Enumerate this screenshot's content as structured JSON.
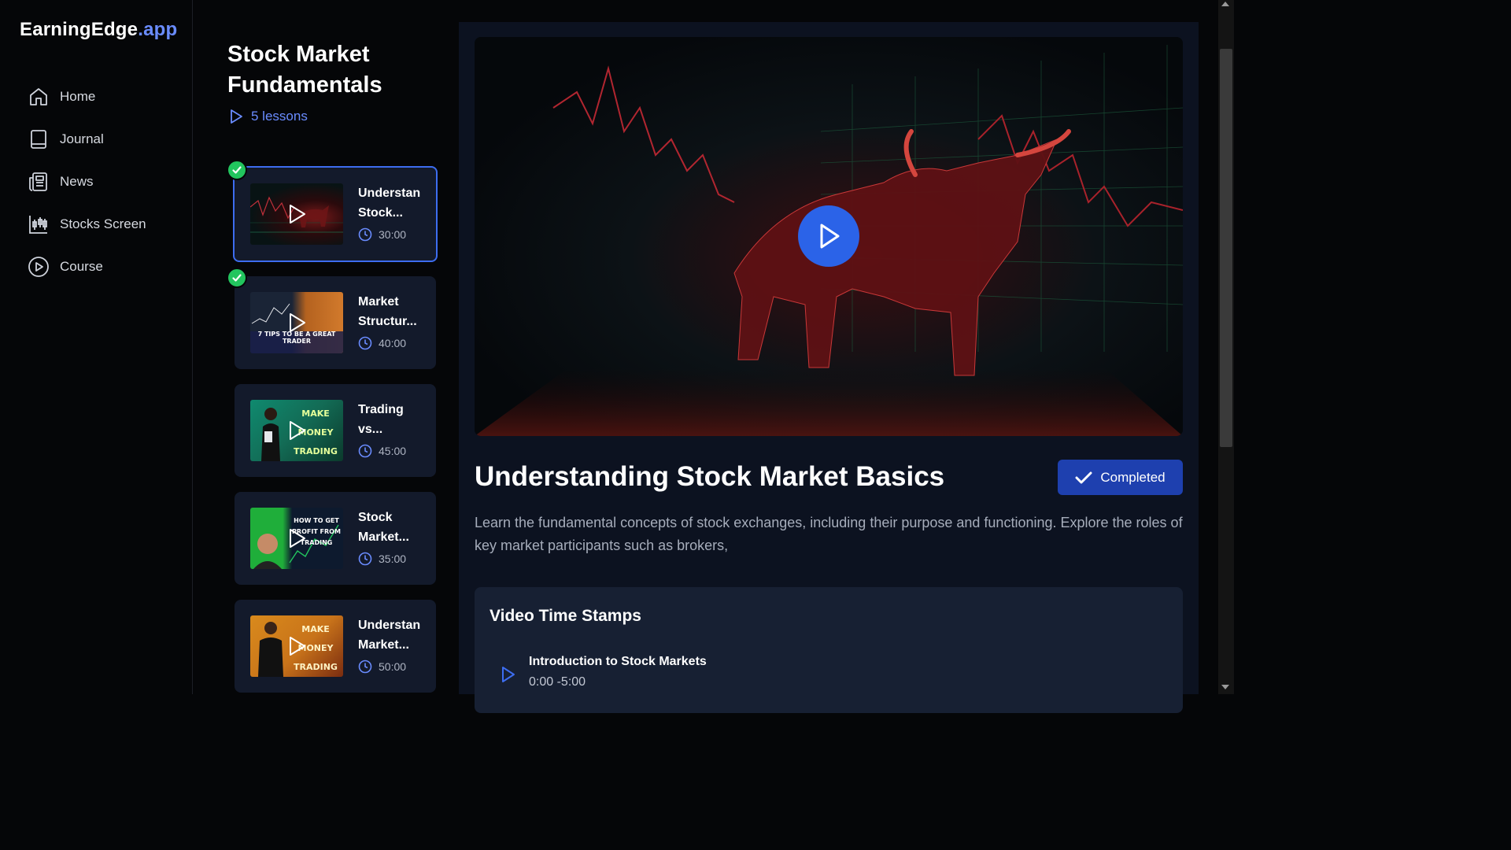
{
  "brand": {
    "name": "EarningEdge",
    "suffix": ".app"
  },
  "sidebar": {
    "items": [
      {
        "label": "Home",
        "icon": "home-icon"
      },
      {
        "label": "Journal",
        "icon": "book-icon"
      },
      {
        "label": "News",
        "icon": "newspaper-icon"
      },
      {
        "label": "Stocks Screen",
        "icon": "candlestick-icon"
      },
      {
        "label": "Course",
        "icon": "play-circle-icon"
      }
    ]
  },
  "course": {
    "title": "Stock Market Fundamentals",
    "lessons_count": "5 lessons"
  },
  "lessons": [
    {
      "title": "Understan Stock...",
      "duration": "30:00",
      "completed": true,
      "active": true
    },
    {
      "title": "Market Structur...",
      "duration": "40:00",
      "completed": true,
      "active": false,
      "thumb_text": "7 TIPS TO BE A GREAT TRADER"
    },
    {
      "title": "Trading vs...",
      "duration": "45:00",
      "completed": false,
      "active": false,
      "thumb_text": "MAKE MONEY TRADING STOCKS"
    },
    {
      "title": "Stock Market...",
      "duration": "35:00",
      "completed": false,
      "active": false,
      "thumb_text": "HOW TO GET PROFIT FROM TRADING"
    },
    {
      "title": "Understan Market...",
      "duration": "50:00",
      "completed": false,
      "active": false,
      "thumb_text": "MAKE MONEY TRADING FOREX"
    }
  ],
  "main": {
    "heading": "Understanding Stock Market Basics",
    "completed_label": "Completed",
    "description": "Learn the fundamental concepts of stock exchanges, including their purpose and functioning. Explore the roles of key market participants such as brokers,",
    "timestamps": {
      "title": "Video Time Stamps",
      "items": [
        {
          "name": "Introduction to Stock Markets",
          "time": "0:00 -5:00"
        }
      ]
    }
  },
  "colors": {
    "accent": "#6a8cff",
    "primary_button": "#1e40af",
    "success": "#22c55e",
    "play_button": "#2b63e8"
  }
}
